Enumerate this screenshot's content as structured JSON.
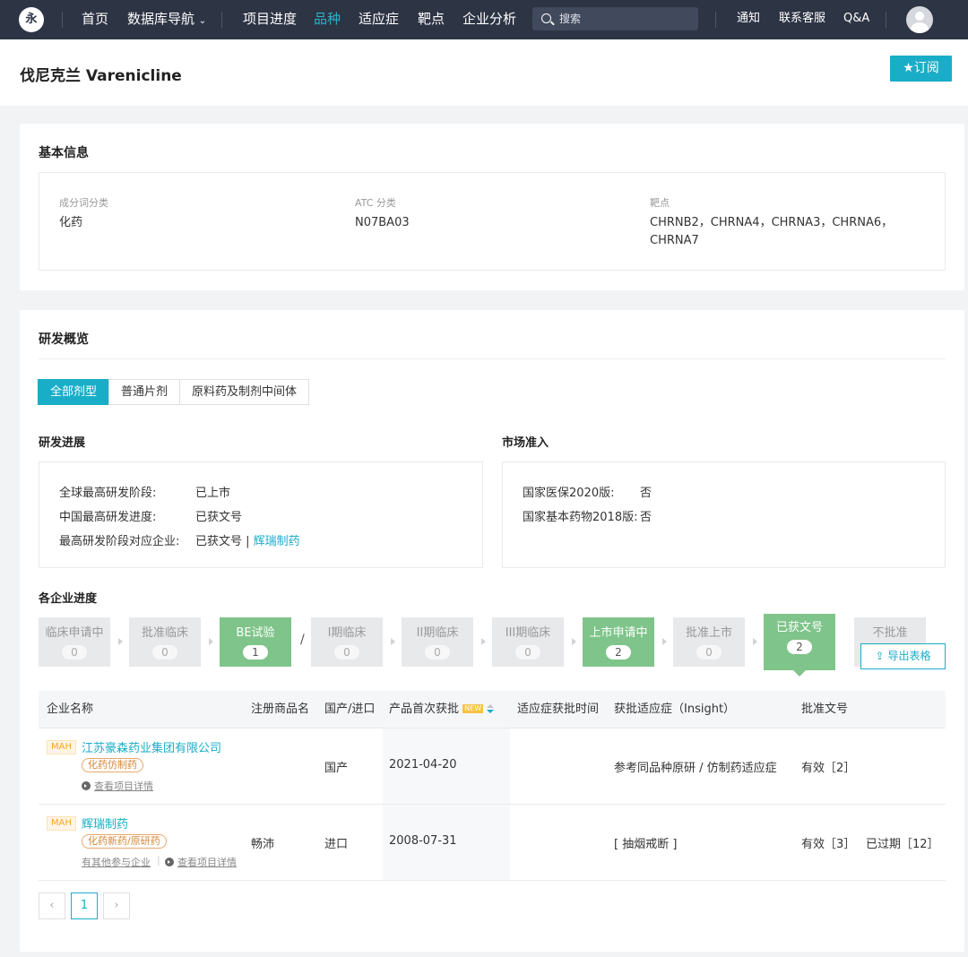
{
  "nav": {
    "logo": "永",
    "items": [
      "首页",
      "数据库导航",
      "项目进度",
      "品种",
      "适应症",
      "靶点",
      "企业分析"
    ],
    "search_placeholder": "搜索",
    "right": [
      "通知",
      "联系客服",
      "Q&A"
    ]
  },
  "page": {
    "title": "伐尼克兰 Varenicline",
    "subscribe": "★订阅"
  },
  "basic": {
    "title": "基本信息",
    "fields": [
      {
        "label": "成分词分类",
        "value": "化药"
      },
      {
        "label": "ATC 分类",
        "value": "N07BA03"
      },
      {
        "label": "靶点",
        "value_line1": "CHRNB2，CHRNA4，CHRNA3，CHRNA6，",
        "value_line2": "CHRNA7"
      }
    ]
  },
  "rd": {
    "title": "研发概览",
    "tabs": [
      "全部剂型",
      "普通片剂",
      "原料药及制剂中间体"
    ],
    "progress_title": "研发进展",
    "market_title": "市场准入",
    "progress": [
      {
        "k": "全球最高研发阶段:",
        "v": "已上市"
      },
      {
        "k": "中国最高研发进度:",
        "v": "已获文号"
      },
      {
        "k": "最高研发阶段对应企业:",
        "v": "已获文号 | ",
        "link": "辉瑞制药"
      }
    ],
    "market": [
      {
        "k": "国家医保2020版:",
        "v": "否"
      },
      {
        "k": "国家基本药物2018版:",
        "v": "否"
      }
    ],
    "company_progress_title": "各企业进度",
    "slash": "/",
    "stages": [
      {
        "name": "临床申请中",
        "count": "0"
      },
      {
        "name": "批准临床",
        "count": "0"
      },
      {
        "name": "BE试验",
        "count": "1"
      },
      {
        "name": "I期临床",
        "count": "0"
      },
      {
        "name": "II期临床",
        "count": "0"
      },
      {
        "name": "III期临床",
        "count": "0"
      },
      {
        "name": "上市申请中",
        "count": "2"
      },
      {
        "name": "批准上市",
        "count": "0"
      },
      {
        "name": "已获文号",
        "count": "2"
      },
      {
        "name": "不批准",
        "count": ""
      }
    ],
    "export": "导出表格"
  },
  "table": {
    "headers": [
      "企业名称",
      "注册商品名",
      "国产/进口",
      "产品首次获批",
      "适应症获批时间",
      "获批适应症（Insight）",
      "批准文号"
    ],
    "new_badge": "NEW",
    "rows": [
      {
        "mah": "MAH",
        "company": "江苏豪森药业集团有限公司",
        "tag": "化药仿制药",
        "detail": "查看项目详情",
        "brand": "",
        "origin": "国产",
        "date": "2021-04-20",
        "ind_time": "",
        "indication": "参考同品种原研 / 仿制药适应症",
        "approval": "有效［2］",
        "approval2": ""
      },
      {
        "mah": "MAH",
        "company": "辉瑞制药",
        "tag": "化药新药/原研药",
        "other": "有其他参与企业",
        "detail": "查看项目详情",
        "brand": "畅沛",
        "origin": "进口",
        "date": "2008-07-31",
        "ind_time": "",
        "indication": "[ 抽烟戒断 ]",
        "approval": "有效［3］",
        "approval2": "已过期［12］"
      }
    ]
  },
  "pagination": {
    "prev": "‹",
    "current": "1",
    "next": "›"
  }
}
